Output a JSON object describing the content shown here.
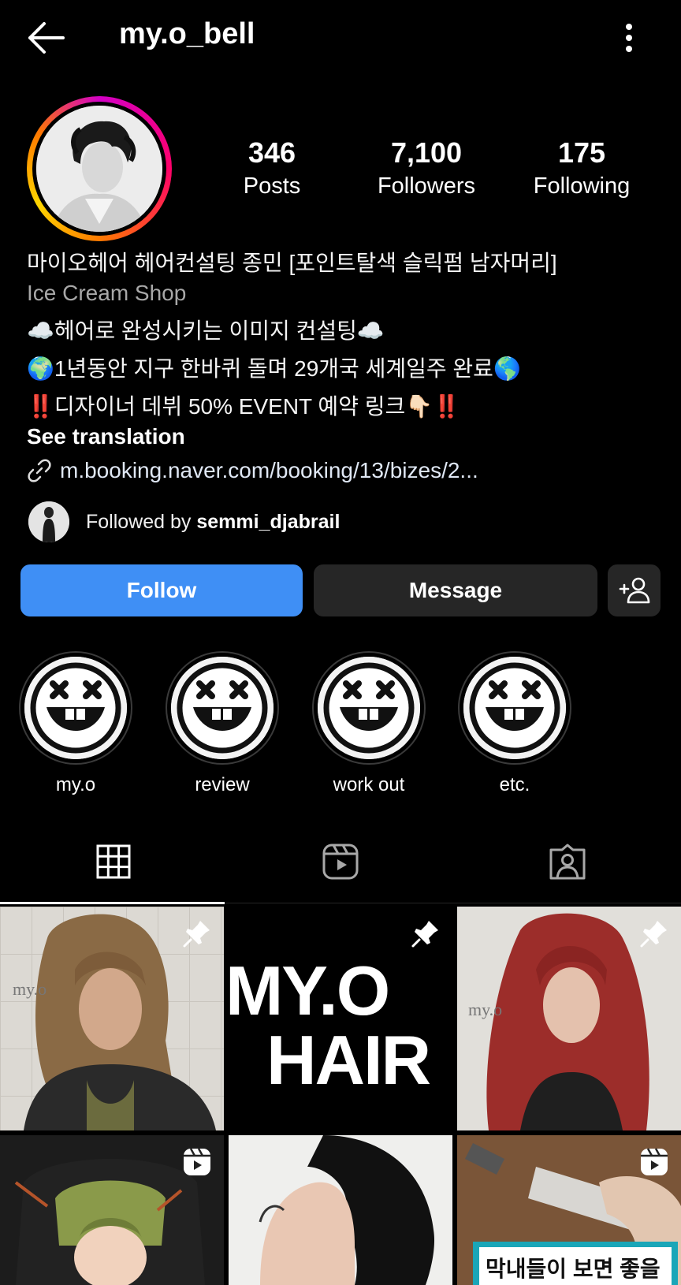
{
  "header": {
    "username": "my.o_bell"
  },
  "stats": [
    {
      "value": "346",
      "label": "Posts"
    },
    {
      "value": "7,100",
      "label": "Followers"
    },
    {
      "value": "175",
      "label": "Following"
    }
  ],
  "bio": {
    "name": "마이오헤어 헤어컨설팅 종민 [포인트탈색 슬릭펌 남자머리]",
    "category": "Ice Cream Shop",
    "lines": [
      "☁️헤어로 완성시키는 이미지 컨설팅☁️",
      "🌍1년동안 지구 한바퀴 돌며 29개국 세계일주 완료🌎",
      "‼️디자이너 데뷔 50% EVENT 예약 링크👇🏻‼️"
    ],
    "see_translation": "See translation",
    "link": "m.booking.naver.com/booking/13/bizes/2..."
  },
  "followed_by": {
    "prefix": "Followed by ",
    "user": "semmi_djabrail"
  },
  "actions": {
    "follow": "Follow",
    "message": "Message"
  },
  "highlights": [
    {
      "label": "my.o"
    },
    {
      "label": "review"
    },
    {
      "label": "work out"
    },
    {
      "label": "etc."
    }
  ],
  "tabs": [
    "grid-icon",
    "reels-icon",
    "tagged-icon"
  ],
  "posts": [
    {
      "type": "pinned",
      "overlay": "my.o"
    },
    {
      "type": "pinned",
      "overlay_lines": [
        "MY.O",
        "HAIR"
      ]
    },
    {
      "type": "pinned",
      "overlay": "my.o"
    },
    {
      "type": "reel"
    },
    {
      "type": "photo"
    },
    {
      "type": "reel",
      "caption": "막내들이 보면 좋을"
    }
  ],
  "colors": {
    "follow_button": "#3f8ff5",
    "secondary_button": "#262626",
    "background": "#000000"
  }
}
